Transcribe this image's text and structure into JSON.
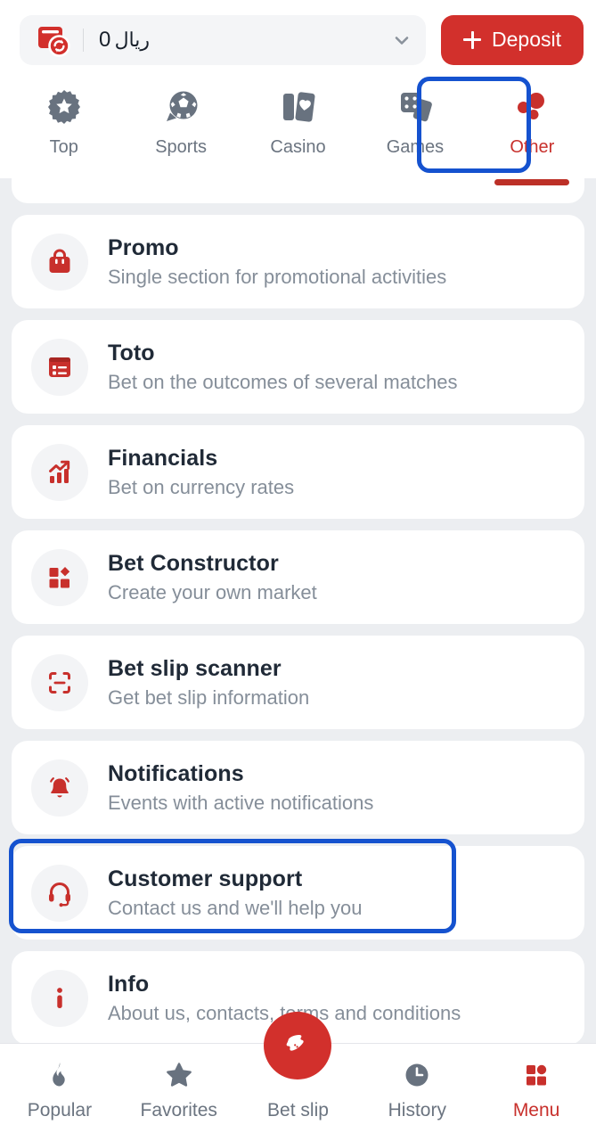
{
  "header": {
    "balance": {
      "amount": "0",
      "currency": "ريال",
      "wallet_icon": "wallet-refresh-icon",
      "chevron_icon": "chevron-down-icon"
    },
    "deposit_button": {
      "label": "Deposit",
      "icon": "plus-icon",
      "color": "#d2302c"
    }
  },
  "category_tabs": [
    {
      "label": "Top",
      "icon": "star-burst-icon",
      "active": false
    },
    {
      "label": "Sports",
      "icon": "soccer-ball-icon",
      "active": false
    },
    {
      "label": "Casino",
      "icon": "playing-cards-icon",
      "active": false
    },
    {
      "label": "Games",
      "icon": "dice-cards-icon",
      "active": false
    },
    {
      "label": "Other",
      "icon": "three-dots-icon",
      "active": true
    }
  ],
  "menu_items": [
    {
      "title": "Promo",
      "subtitle": "Single section for promotional activities",
      "icon": "shopping-bag-icon",
      "highlighted": false
    },
    {
      "title": "Toto",
      "subtitle": "Bet on the outcomes of several matches",
      "icon": "list-card-icon",
      "highlighted": false
    },
    {
      "title": "Financials",
      "subtitle": "Bet on currency rates",
      "icon": "chart-trend-icon",
      "highlighted": false
    },
    {
      "title": "Bet Constructor",
      "subtitle": "Create your own market",
      "icon": "blocks-diamond-icon",
      "highlighted": false
    },
    {
      "title": "Bet slip scanner",
      "subtitle": "Get bet slip information",
      "icon": "scan-frame-icon",
      "highlighted": false
    },
    {
      "title": "Notifications",
      "subtitle": "Events with active notifications",
      "icon": "bell-icon",
      "highlighted": false
    },
    {
      "title": "Customer support",
      "subtitle": "Contact us and we'll help you",
      "icon": "headset-icon",
      "highlighted": true
    },
    {
      "title": "Info",
      "subtitle": "About us, contacts, terms and conditions",
      "icon": "info-icon",
      "highlighted": false
    }
  ],
  "bottom_nav": [
    {
      "label": "Popular",
      "icon": "flame-icon",
      "active": false
    },
    {
      "label": "Favorites",
      "icon": "star-icon",
      "active": false
    },
    {
      "label": "Bet slip",
      "icon": "ticket-icon",
      "active": false,
      "fab": true
    },
    {
      "label": "History",
      "icon": "clock-icon",
      "active": false
    },
    {
      "label": "Menu",
      "icon": "grid-squares-icon",
      "active": true
    }
  ],
  "colors": {
    "accent_red": "#d2302c",
    "icon_red": "#c8302c",
    "focus_blue": "#1552cf",
    "inactive_gray": "#6b7480",
    "page_bg": "#eceef1"
  }
}
